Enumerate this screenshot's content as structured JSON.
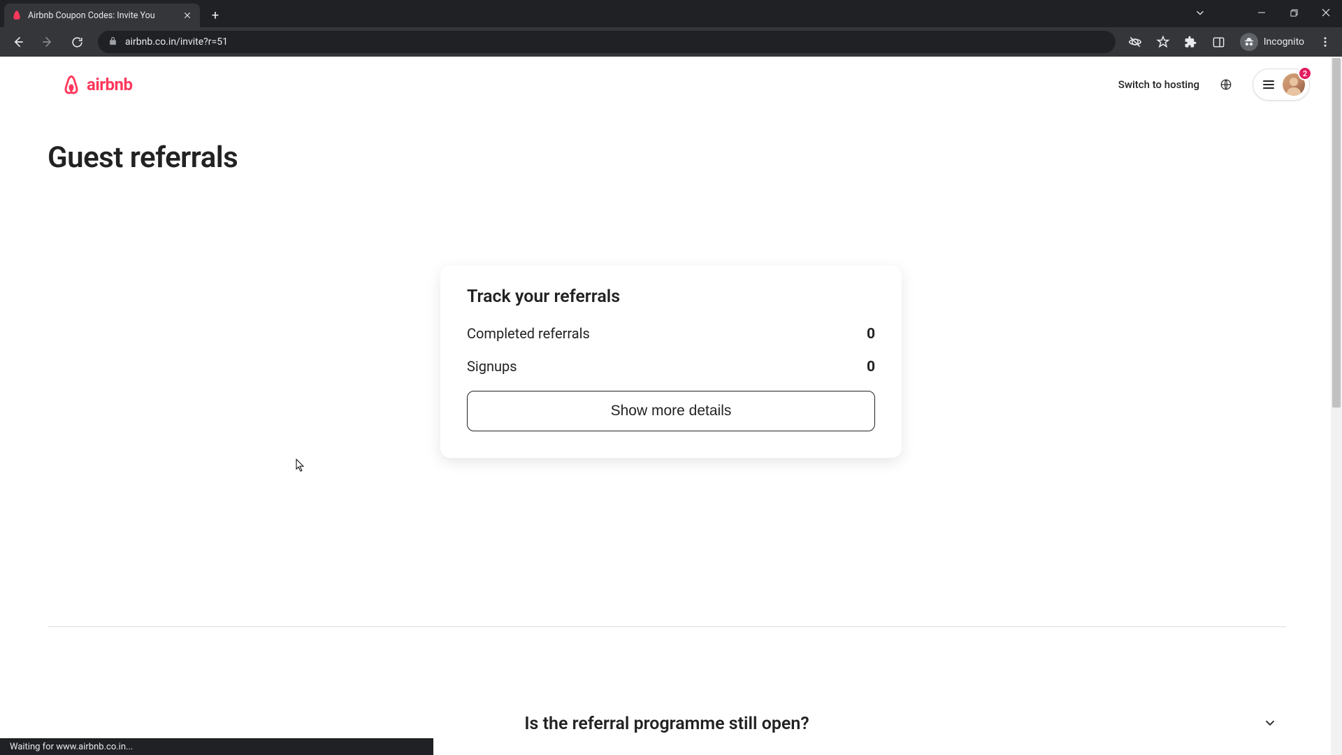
{
  "browser": {
    "tab_title": "Airbnb Coupon Codes: Invite You",
    "url_display": "airbnb.co.in/invite?r=51",
    "incognito_label": "Incognito",
    "status_text": "Waiting for www.airbnb.co.in..."
  },
  "header": {
    "logo_text": "airbnb",
    "switch_link": "Switch to hosting",
    "notification_count": "2"
  },
  "page": {
    "title": "Guest referrals"
  },
  "card": {
    "title": "Track your referrals",
    "stats": [
      {
        "label": "Completed referrals",
        "value": "0"
      },
      {
        "label": "Signups",
        "value": "0"
      }
    ],
    "button": "Show more details"
  },
  "faq": {
    "question": "Is the referral programme still open?"
  },
  "colors": {
    "brand": "#ff385c",
    "badge": "#e31c5f"
  }
}
